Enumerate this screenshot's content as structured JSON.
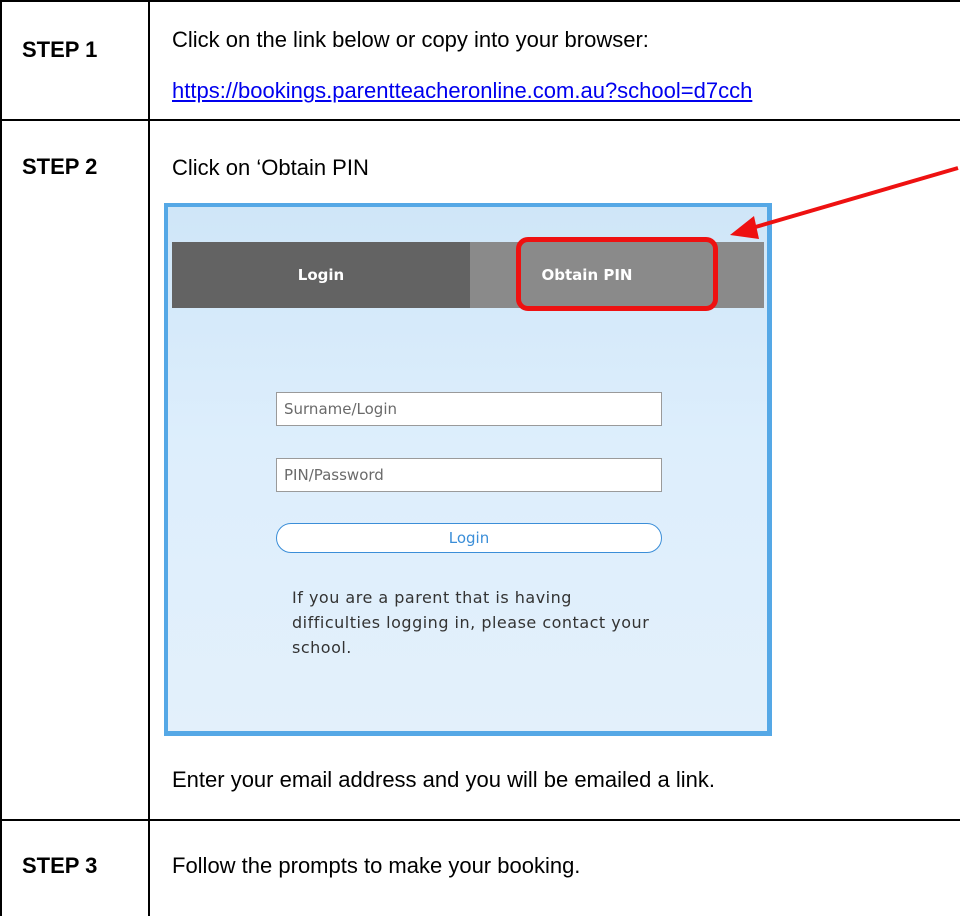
{
  "step1": {
    "label": "STEP 1",
    "instruction": "Click on the link below or copy into your browser:",
    "link": "https://bookings.parentteacheronline.com.au?school=d7cch"
  },
  "step2": {
    "label": "STEP 2",
    "instruction": "Click on ‘Obtain PIN",
    "login_panel": {
      "tab_login": "Login",
      "tab_obtain_pin": "Obtain PIN",
      "surname_placeholder": "Surname/Login",
      "pin_placeholder": "PIN/Password",
      "login_button": "Login",
      "help_text": "If you are a parent that is having difficulties logging in, please contact your school."
    },
    "after_text": "Enter your email address and you will be emailed a link."
  },
  "step3": {
    "label": "STEP 3",
    "instruction": "Follow the prompts to make your booking."
  },
  "colors": {
    "link": "#0000ee",
    "highlight": "#ee1111",
    "panel_border": "#55a8e6",
    "tab_login_bg": "#636363",
    "tab_obtain_bg": "#8a8a8a",
    "button_accent": "#3b8ed8"
  }
}
